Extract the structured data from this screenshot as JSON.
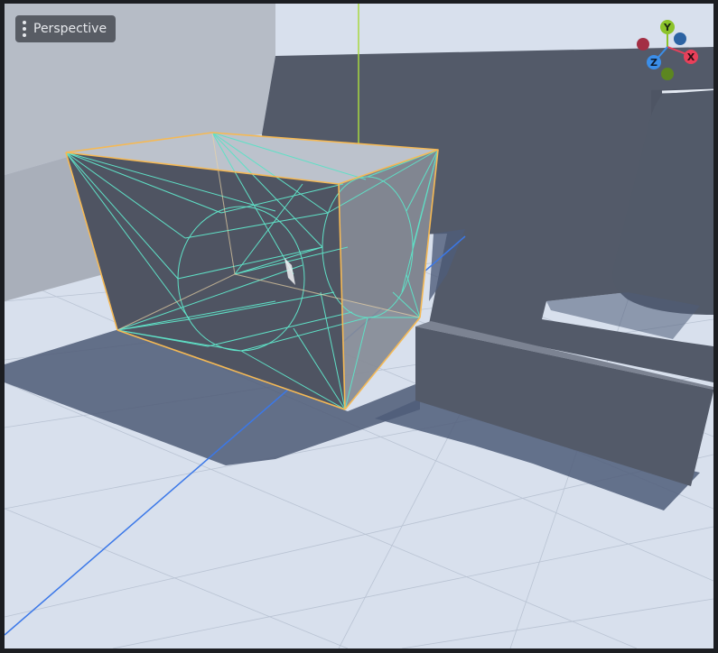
{
  "viewport": {
    "menu_label": "Perspective",
    "menu_icon": "kebab-menu-icon"
  },
  "gizmo": {
    "y_label": "Y",
    "x_label": "X",
    "z_label": "Z",
    "colors": {
      "y": "#8cc32a",
      "x": "#e8405a",
      "z": "#3b8ee8",
      "neg_x": "#a32e44",
      "neg_y": "#5c8620",
      "neg_z": "#2c63a3"
    }
  },
  "colors": {
    "floor": "#d9e1ee",
    "wall": "#545b6b",
    "selection_outline": "#f5b955",
    "wireframe": "#5fe0c6",
    "x_axis_line": "#e8405a",
    "y_axis_line": "#b6e03a",
    "z_axis_line": "#3b78e8"
  }
}
